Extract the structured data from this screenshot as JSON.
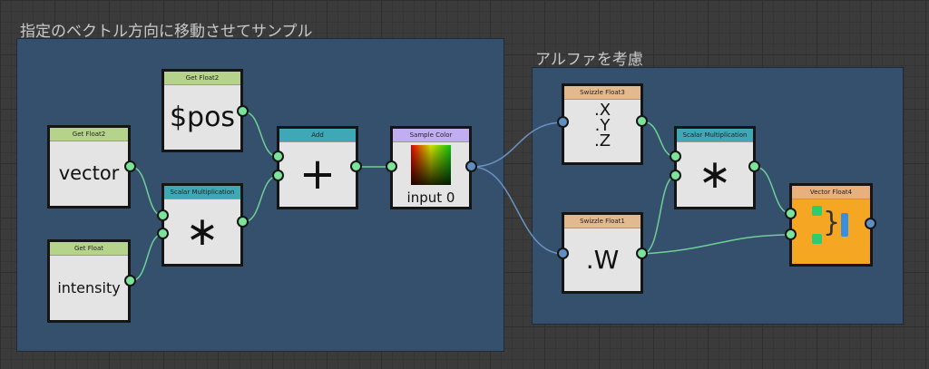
{
  "groups": {
    "left_title": "指定のベクトル方向に移動させてサンプル",
    "right_title": "アルファを考慮"
  },
  "nodes": {
    "get_float2_pos": {
      "header": "Get Float2",
      "value": "$pos"
    },
    "get_float2_vector": {
      "header": "Get Float2",
      "value": "vector"
    },
    "get_float_intensity": {
      "header": "Get Float",
      "value": "intensity"
    },
    "scalar_mult_1": {
      "header": "Scalar Multiplication",
      "symbol": "∗"
    },
    "add": {
      "header": "Add",
      "symbol": "+"
    },
    "sample_color": {
      "header": "Sample Color",
      "value": "input 0"
    },
    "swizzle_float3": {
      "header": "Swizzle Float3",
      "lines": [
        ".X",
        ".Y",
        ".Z"
      ]
    },
    "swizzle_float1": {
      "header": "Swizzle Float1",
      "value": ".W"
    },
    "scalar_mult_2": {
      "header": "Scalar Multiplication",
      "symbol": "∗"
    },
    "vector_float4": {
      "header": "Vector Float4"
    }
  },
  "colors": {
    "get_header": "#b5d38b",
    "op_header": "#3fa8b6",
    "sample_header": "#c0adf2",
    "swizzle_header": "#e3b98f",
    "vector_header": "#e8b07d",
    "vector_body": "#f5a623",
    "group_bg": "#34506d",
    "green_port": "#7be39a",
    "blue_port": "#5f8fc0"
  }
}
